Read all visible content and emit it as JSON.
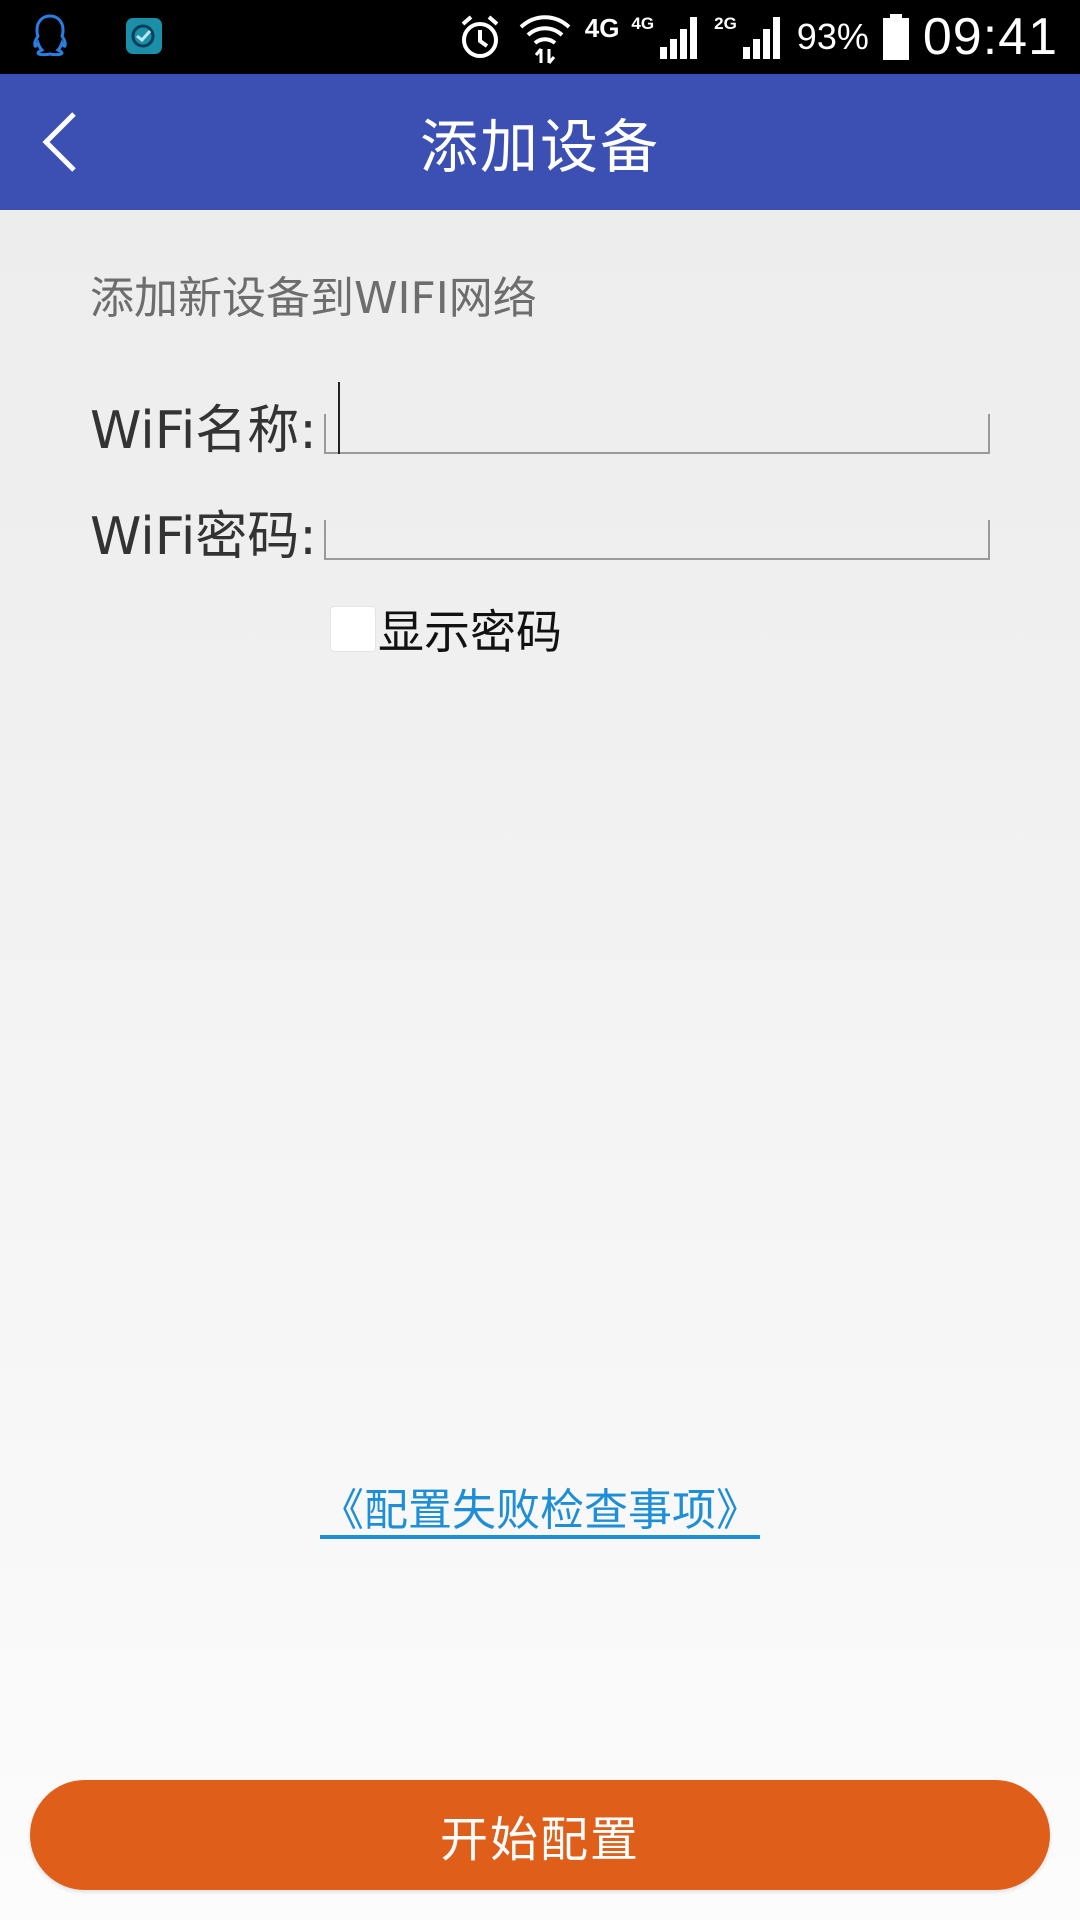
{
  "status_bar": {
    "network_1": "4G",
    "network_2": "4G",
    "network_3": "2G",
    "battery": "93%",
    "time": "09:41",
    "icons": [
      "qq-icon",
      "app-notification-icon",
      "alarm-icon",
      "wifi-icon",
      "signal-icon",
      "battery-icon"
    ]
  },
  "header": {
    "title": "添加设备"
  },
  "form": {
    "hint": "添加新设备到WIFI网络",
    "wifi_name_label": "WiFi名称:",
    "wifi_name_value": "",
    "wifi_password_label": "WiFi密码:",
    "wifi_password_value": "",
    "show_password_label": "显示密码",
    "show_password_checked": false
  },
  "help_link": "《配置失败检查事项》",
  "start_button": "开始配置",
  "colors": {
    "header": "#3b50b2",
    "button": "#df5f1a",
    "link": "#1e8ed6"
  }
}
